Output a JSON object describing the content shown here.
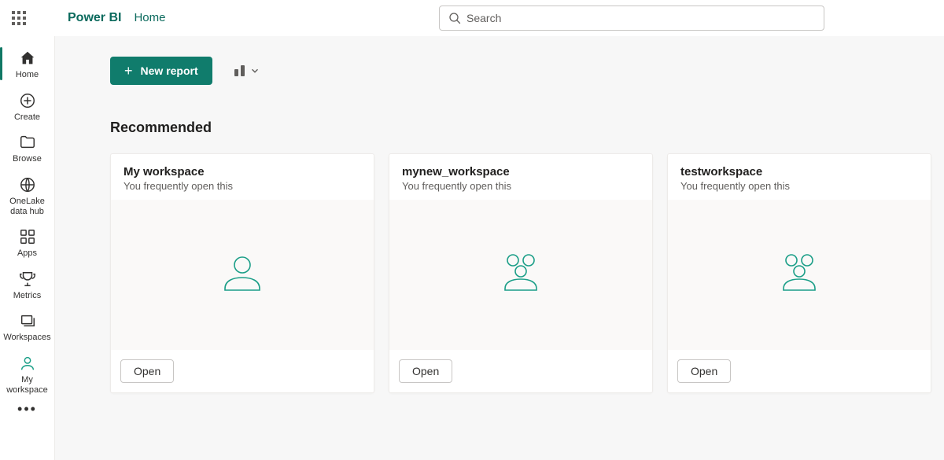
{
  "header": {
    "brand": "Power BI",
    "page": "Home",
    "search_placeholder": "Search"
  },
  "sidebar": {
    "items": [
      {
        "key": "home",
        "label": "Home"
      },
      {
        "key": "create",
        "label": "Create"
      },
      {
        "key": "browse",
        "label": "Browse"
      },
      {
        "key": "onelake",
        "label": "OneLake data hub"
      },
      {
        "key": "apps",
        "label": "Apps"
      },
      {
        "key": "metrics",
        "label": "Metrics"
      },
      {
        "key": "workspaces",
        "label": "Workspaces"
      },
      {
        "key": "myworkspace",
        "label": "My workspace"
      }
    ]
  },
  "toolbar": {
    "new_report_label": "New report"
  },
  "recommended": {
    "title": "Recommended",
    "open_label": "Open",
    "cards": [
      {
        "title": "My workspace",
        "subtitle": "You frequently open this",
        "icon": "single"
      },
      {
        "title": "mynew_workspace",
        "subtitle": "You frequently open this",
        "icon": "group"
      },
      {
        "title": "testworkspace",
        "subtitle": "You frequently open this",
        "icon": "group"
      }
    ]
  }
}
